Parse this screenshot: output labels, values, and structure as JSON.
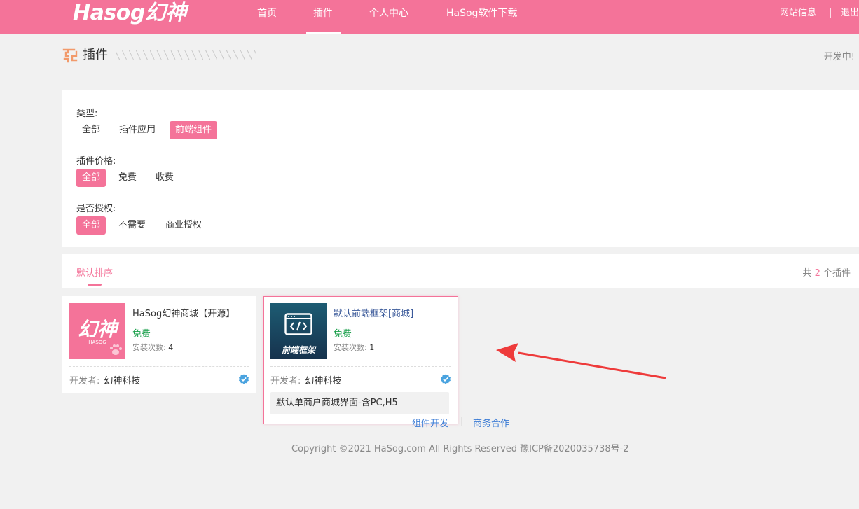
{
  "header": {
    "logo": "Hasog幻神",
    "nav": [
      {
        "label": "首页"
      },
      {
        "label": "插件"
      },
      {
        "label": "个人中心"
      },
      {
        "label": "HaSog软件下载"
      }
    ],
    "site_info": "网站信息",
    "separator": "|",
    "logout": "退出"
  },
  "page": {
    "title": "插件",
    "status": "开发中!"
  },
  "filters": {
    "type_label": "类型:",
    "type_options": [
      "全部",
      "插件应用",
      "前端组件"
    ],
    "price_label": "插件价格:",
    "price_options": [
      "全部",
      "免费",
      "收费"
    ],
    "license_label": "是否授权:",
    "license_options": [
      "全部",
      "不需要",
      "商业授权"
    ]
  },
  "sort": {
    "default_label": "默认排序",
    "count_prefix": "共",
    "count": "2",
    "count_suffix": "个插件"
  },
  "plugins": [
    {
      "title": "HaSog幻神商城【开源】",
      "price": "免费",
      "installs_label": "安装次数:",
      "installs": "4",
      "dev_label": "开发者:",
      "developer": "幻神科技",
      "thumb_text": "幻神",
      "thumb_sub": "HASOG"
    },
    {
      "title": "默认前端框架[商城]",
      "price": "免费",
      "installs_label": "安装次数:",
      "installs": "1",
      "dev_label": "开发者:",
      "developer": "幻神科技",
      "thumb_text": "前端框架",
      "description": "默认单商户商城界面-含PC,H5"
    }
  ],
  "footer": {
    "link1": "组件开发",
    "separator": "|",
    "link2": "商务合作",
    "copyright": "Copyright ©2021 HaSog.com   All Rights Reserved   豫ICP备2020035738号-2"
  },
  "colors": {
    "brand": "#f47399",
    "price_green": "#1aa04b",
    "link_blue": "#3a7bd5",
    "annotation_arrow": "#ee3b3b"
  }
}
